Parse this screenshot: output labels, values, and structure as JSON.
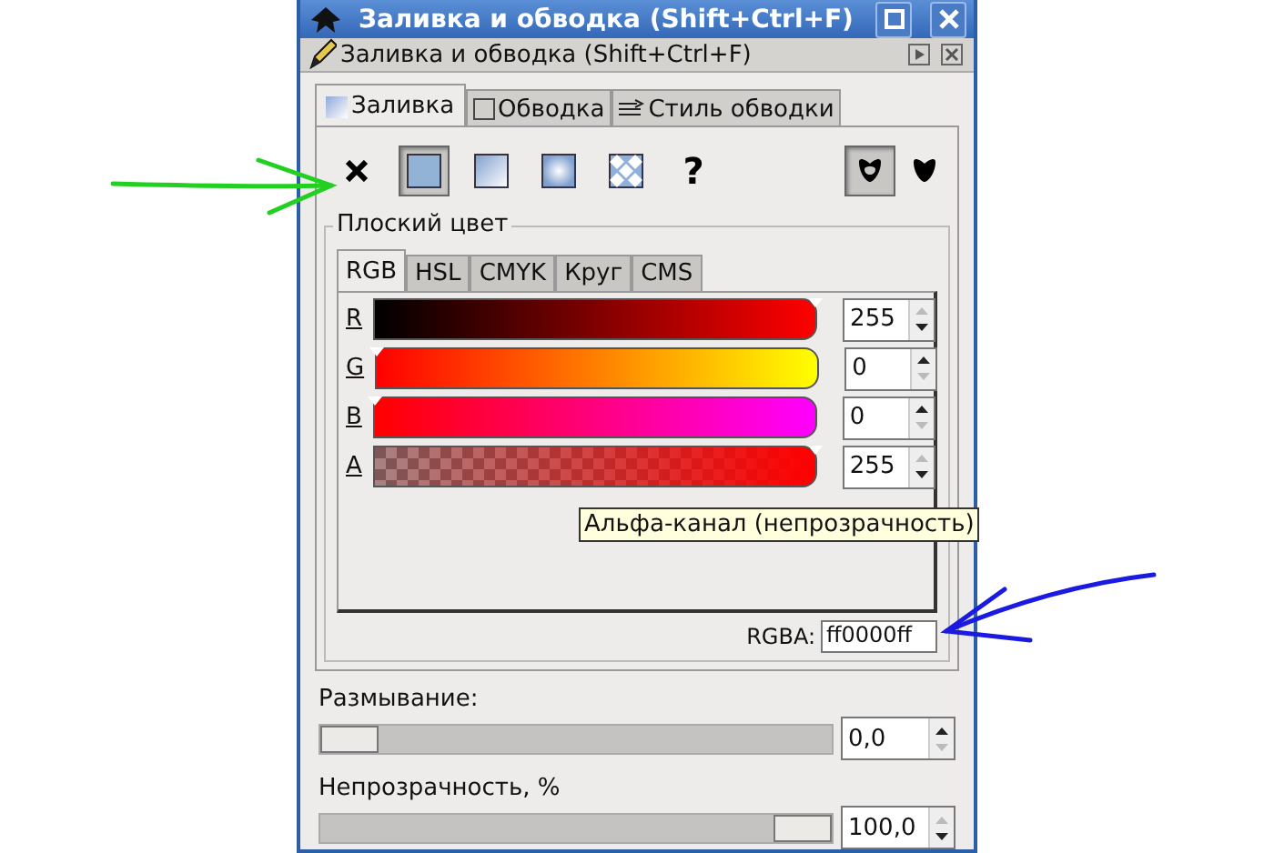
{
  "window": {
    "title": "Заливка и обводка (Shift+Ctrl+F)"
  },
  "dock": {
    "title": "Заливка и обводка (Shift+Ctrl+F)"
  },
  "tabs": [
    {
      "label": "Заливка",
      "kind": "fill",
      "selected": true
    },
    {
      "label": "Обводка",
      "kind": "stroke",
      "selected": false
    },
    {
      "label": "Стиль обводки",
      "kind": "style",
      "selected": false
    }
  ],
  "fill_modes": [
    {
      "kind": "none",
      "selected": false
    },
    {
      "kind": "flat",
      "selected": true
    },
    {
      "kind": "linear",
      "selected": false
    },
    {
      "kind": "radial",
      "selected": false
    },
    {
      "kind": "pattern",
      "selected": false
    },
    {
      "kind": "unset",
      "label": "?",
      "selected": false
    }
  ],
  "fill_rules": [
    {
      "kind": "evenodd",
      "selected": true
    },
    {
      "kind": "nonzero",
      "selected": false
    }
  ],
  "frame": {
    "title": "Плоский цвет",
    "tabs": [
      {
        "label": "RGB",
        "selected": true
      },
      {
        "label": "HSL",
        "selected": false
      },
      {
        "label": "CMYK",
        "selected": false
      },
      {
        "label": "Круг",
        "selected": false
      },
      {
        "label": "CMS",
        "selected": false
      }
    ],
    "channels": [
      {
        "name": "R",
        "kind": "r",
        "level": 1,
        "value": "255"
      },
      {
        "name": "G",
        "kind": "g",
        "level": 0,
        "value": "0"
      },
      {
        "name": "B",
        "kind": "b",
        "level": 0,
        "value": "0"
      },
      {
        "name": "A",
        "kind": "a",
        "level": 1,
        "value": "255"
      }
    ],
    "rgba": {
      "label": "RGBA:",
      "value": "ff0000ff"
    }
  },
  "tooltip": "Альфа-канал (непрозрачность)",
  "blur": {
    "label": "Размывание:",
    "level": 0,
    "value": "0,0"
  },
  "opacity": {
    "label": "Непрозрачность, %",
    "level": 1,
    "value": "100,0"
  }
}
